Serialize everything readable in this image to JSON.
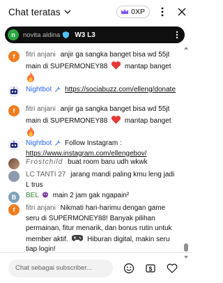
{
  "header": {
    "title": "Chat teratas",
    "xp": "0XP"
  },
  "pinned": {
    "avatar": "n",
    "name": "novita aldina",
    "text": "W3 L3"
  },
  "messages": [
    {
      "avatar": "f",
      "author": "fitri anjani",
      "text1": "anjir ga sangka banget bisa wd 55jt main di SUPERMONEY88",
      "text2": "mantap banget"
    },
    {
      "author": "Nightbot",
      "link": "https://sociabuzz.com/elleng/donate"
    },
    {
      "avatar": "f",
      "author": "fitri anjani",
      "text1": "anjir ga sangka banget bisa wd 55jt main di SUPERMONEY88",
      "text2": "mantap banget"
    },
    {
      "author": "Nightbot",
      "text": "Follow Instagram :",
      "link": "https://www.instagram.com/ellengebov/"
    },
    {
      "author": "Frostchild",
      "text": "buat room baru udh wkwk"
    },
    {
      "author": "LC TANTI 27",
      "text": "jarang mandi paling kmu leng jadi L trus"
    },
    {
      "avatar": "B",
      "author": "BEL",
      "text": "main 2 jam gak ngapain²"
    },
    {
      "avatar": "f",
      "author": "fitri anjani",
      "text1": "Nikmati hari-harimu dengan game seru di SUPERMONEY88! Banyak pilihan permainan, fitur menarik, dan bonus rutin untuk member aktif.",
      "text2": "Hiburan digital, makin seru tiap login!"
    }
  ],
  "footer": {
    "placeholder": "Chat sebagai subscriber..."
  }
}
